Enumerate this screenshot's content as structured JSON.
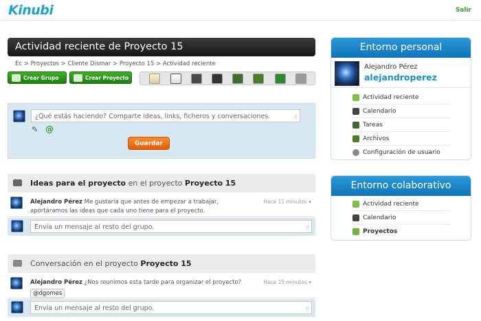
{
  "app": {
    "logo": "Kinubi",
    "logout": "Salir"
  },
  "page": {
    "title": "Actividad reciente de Proyecto 15",
    "breadcrumb": [
      "Ec",
      "Proyectos",
      "Cliente Dismar",
      "Proyecto 15",
      "Actividad reciente"
    ],
    "breadcrumb_sep": ">"
  },
  "actions": {
    "create_group": "Crear Grupo",
    "create_project": "Crear Proyecto"
  },
  "toolbar_icons": [
    "notes-icon",
    "calendar-icon",
    "chat-icon",
    "file-icon",
    "tasks-icon",
    "folder-icon",
    "users-icon",
    "settings-icon"
  ],
  "composer": {
    "placeholder": "¿Qué estás haciendo? Comparte ideas, links, ficheros y conversaciones.",
    "submit": "Guardar",
    "mention_symbol": "@"
  },
  "groups": [
    {
      "title": "Ideas para el proyecto",
      "context": "en el proyecto",
      "project": "Proyecto 15",
      "messages": [
        {
          "author": "Alejandro Pérez",
          "text": "Me gustaría que antes de empezar a trabajar, aportáramos las ideas que cada uno tiene para el proyecto.",
          "time": "Hace 11 minutos"
        }
      ],
      "reply_placeholder": "Envía un mensaje al resto del grupo."
    },
    {
      "title": "Conversación",
      "context": "en el proyecto",
      "project": "Proyecto 15",
      "messages": [
        {
          "author": "Alejandro Pérez",
          "text": "¿Nos reunimos esta tarde para organizar el proyecto?",
          "mention": "@dgomes",
          "time": "Hace 15 minutos"
        }
      ],
      "reply_placeholder": "Envía un mensaje al resto del grupo."
    }
  ],
  "personal": {
    "title": "Entorno personal",
    "name": "Alejandro Pérez",
    "username": "alejandroperez",
    "items": [
      "Actividad reciente",
      "Calendario",
      "Tareas",
      "Archivos",
      "Configuración de usuario"
    ]
  },
  "collab": {
    "title": "Entorno colaborativo",
    "items": [
      "Actividad reciente",
      "Calendario",
      "Proyectos"
    ],
    "active": "Proyectos"
  },
  "colors": {
    "accent_blue": "#1590c8",
    "accent_green": "#3a9a2a",
    "button_orange": "#f07010",
    "title_dark": "#222222",
    "post_bg": "#d7e8f3"
  }
}
